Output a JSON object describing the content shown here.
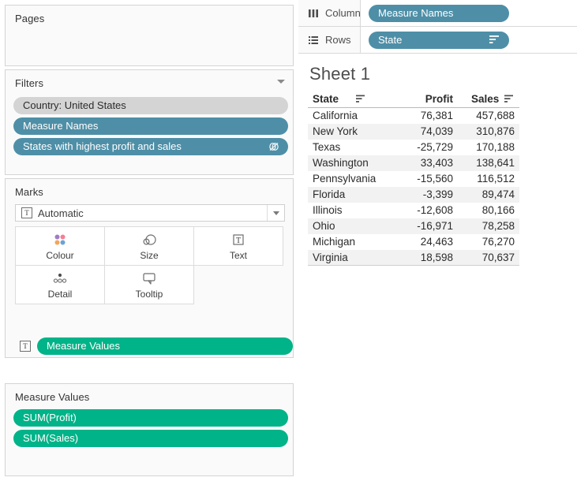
{
  "left_panel": {
    "pages": {
      "title": "Pages"
    },
    "filters": {
      "title": "Filters",
      "caret_icon": "chevron-down-icon",
      "pills": [
        {
          "label": "Country: United States",
          "style": "grey",
          "icon": ""
        },
        {
          "label": "Measure Names",
          "style": "blue",
          "icon": ""
        },
        {
          "label": "States with highest profit and sales",
          "style": "blue",
          "icon": "context-filter-icon"
        }
      ]
    },
    "marks": {
      "title": "Marks",
      "mark_type": {
        "label": "Automatic",
        "icon": "text-mark-icon",
        "caret_icon": "chevron-down-icon"
      },
      "buttons": [
        {
          "label": "Colour",
          "icon": "colour-dots-icon"
        },
        {
          "label": "Size",
          "icon": "size-circles-icon"
        },
        {
          "label": "Text",
          "icon": "text-box-icon"
        },
        {
          "label": "Detail",
          "icon": "detail-dots-icon"
        },
        {
          "label": "Tooltip",
          "icon": "tooltip-bubble-icon"
        }
      ],
      "encoding_pill": {
        "label": "Measure Values",
        "style": "green",
        "icon": "text-mark-icon"
      }
    },
    "measure_values": {
      "title": "Measure Values",
      "pills": [
        {
          "label": "SUM(Profit)",
          "style": "green"
        },
        {
          "label": "SUM(Sales)",
          "style": "green"
        }
      ]
    }
  },
  "shelves": {
    "columns": {
      "label": "Columns",
      "icon": "columns-icon",
      "pill": {
        "label": "Measure Names",
        "style": "blue",
        "sort_icon": ""
      }
    },
    "rows": {
      "label": "Rows",
      "icon": "rows-icon",
      "pill": {
        "label": "State",
        "style": "blue",
        "sort_icon": "sort-descending-icon"
      }
    }
  },
  "worksheet": {
    "title": "Sheet 1",
    "chart_data": {
      "type": "table",
      "title": "Sheet 1",
      "columns": [
        "State",
        "Profit",
        "Sales"
      ],
      "column_sort_icons": [
        "sort-descending-icon",
        "",
        "sort-descending-icon"
      ],
      "rows": [
        {
          "state": "California",
          "profit": "76,381",
          "sales": "457,688"
        },
        {
          "state": "New York",
          "profit": "74,039",
          "sales": "310,876"
        },
        {
          "state": "Texas",
          "profit": "-25,729",
          "sales": "170,188"
        },
        {
          "state": "Washington",
          "profit": "33,403",
          "sales": "138,641"
        },
        {
          "state": "Pennsylvania",
          "profit": "-15,560",
          "sales": "116,512"
        },
        {
          "state": "Florida",
          "profit": "-3,399",
          "sales": "89,474"
        },
        {
          "state": "Illinois",
          "profit": "-12,608",
          "sales": "80,166"
        },
        {
          "state": "Ohio",
          "profit": "-16,971",
          "sales": "78,258"
        },
        {
          "state": "Michigan",
          "profit": "24,463",
          "sales": "76,270"
        },
        {
          "state": "Virginia",
          "profit": "18,598",
          "sales": "70,637"
        }
      ],
      "profit_values": [
        76381,
        74039,
        -25729,
        33403,
        -15560,
        -3399,
        -12608,
        -16971,
        24463,
        18598
      ],
      "sales_values": [
        457688,
        310876,
        170188,
        138641,
        116512,
        89474,
        80166,
        78258,
        76270,
        70637
      ],
      "sorted_by": "Sales",
      "sort_order": "descending"
    }
  },
  "colors": {
    "dimension_pill": "#4e8fa7",
    "measure_pill": "#00b388",
    "filter_pill": "#d4d4d4",
    "panel_bg": "#fafafa",
    "row_band": "#f2f2f2"
  }
}
